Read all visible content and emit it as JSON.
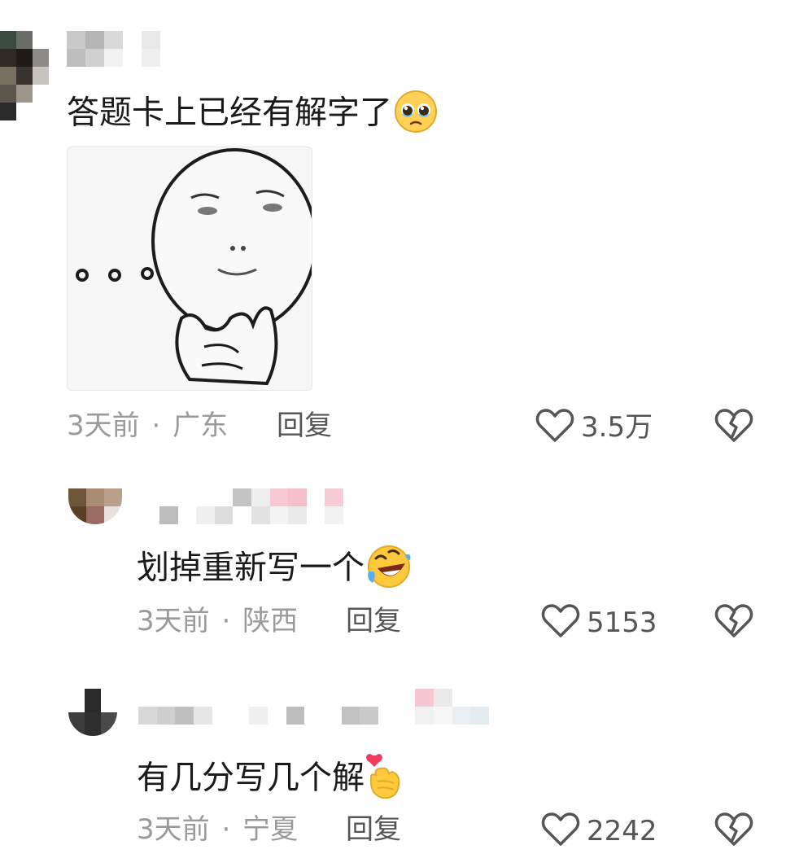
{
  "comments": [
    {
      "text": "答题卡上已经有解字了",
      "emoji": "pleading-face-emoji",
      "time": "3天前",
      "separator": "·",
      "location": "广东",
      "reply_label": "回复",
      "likes": "3.5万",
      "has_sticker": true,
      "sticker": "thinking-meme-sticker"
    },
    {
      "text": "划掉重新写一个",
      "emoji": "rolling-on-floor-laughing-emoji",
      "time": "3天前",
      "separator": "·",
      "location": "陕西",
      "reply_label": "回复",
      "likes": "5153"
    },
    {
      "text": "有几分写几个解",
      "emoji": "finger-heart-emoji",
      "time": "3天前",
      "separator": "·",
      "location": "宁夏",
      "reply_label": "回复",
      "likes": "2242"
    }
  ],
  "icons": {
    "like": "heart-outline-icon",
    "dislike": "broken-heart-icon"
  },
  "colors": {
    "text": "#1a1a1a",
    "meta": "#9a9a9a",
    "action": "#555555",
    "background": "#ffffff"
  }
}
